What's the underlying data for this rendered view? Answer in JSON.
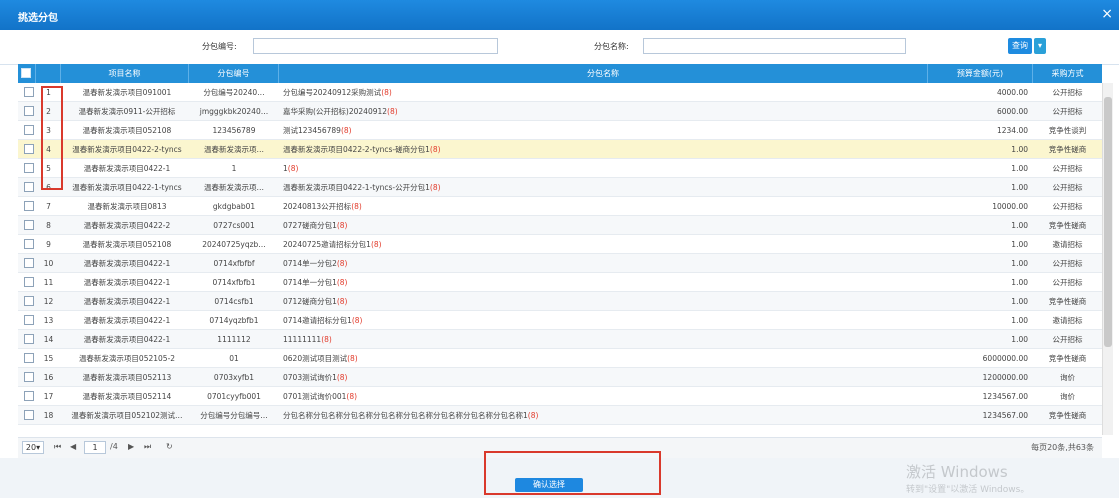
{
  "window": {
    "title": "挑选分包",
    "close_glyph": "×"
  },
  "search": {
    "package_no_label": "分包编号:",
    "package_no_value": "",
    "package_name_label": "分包名称:",
    "package_name_value": "",
    "search_button": "查询",
    "dropdown_glyph": "▾"
  },
  "table": {
    "headers": [
      "",
      "",
      "项目名称",
      "分包编号",
      "分包名称",
      "预算金额(元)",
      "采购方式"
    ],
    "rows": [
      {
        "num": "1",
        "project": "温春新发演示项目091001",
        "pkg_no": "分包编号20240…",
        "pkg_name": "分包编号20240912采购测试",
        "mark": "(8)",
        "amount": "4000.00",
        "method": "公开招标"
      },
      {
        "num": "2",
        "project": "温春新发演示0911-公开招标",
        "pkg_no": "jmgggkbk20240…",
        "pkg_name": "嘉华采购(公开招标)20240912",
        "mark": "(8)",
        "amount": "6000.00",
        "method": "公开招标"
      },
      {
        "num": "3",
        "project": "温春新发演示项目052108",
        "pkg_no": "123456789",
        "pkg_name": "测试123456789",
        "mark": "(8)",
        "amount": "1234.00",
        "method": "竞争性谈判"
      },
      {
        "num": "4",
        "project": "温春新发演示项目0422-2-tyncs",
        "pkg_no": "温春新发演示项…",
        "pkg_name": "温春新发演示项目0422-2-tyncs-磋商分包1",
        "mark": "(8)",
        "amount": "1.00",
        "method": "竞争性磋商"
      },
      {
        "num": "5",
        "project": "温春新发演示项目0422-1",
        "pkg_no": "1",
        "pkg_name": "1",
        "mark": "(8)",
        "amount": "1.00",
        "method": "公开招标"
      },
      {
        "num": "6",
        "project": "温春新发演示项目0422-1-tyncs",
        "pkg_no": "温春新发演示项…",
        "pkg_name": "温春新发演示项目0422-1-tyncs-公开分包1",
        "mark": "(8)",
        "amount": "1.00",
        "method": "公开招标"
      },
      {
        "num": "7",
        "project": "温春新发演示项目0813",
        "pkg_no": "gkdgbab01",
        "pkg_name": "20240813公开招标",
        "mark": "(8)",
        "amount": "10000.00",
        "method": "公开招标"
      },
      {
        "num": "8",
        "project": "温春新发演示项目0422-2",
        "pkg_no": "0727cs001",
        "pkg_name": "0727磋商分包1",
        "mark": "(8)",
        "amount": "1.00",
        "method": "竞争性磋商"
      },
      {
        "num": "9",
        "project": "温春新发演示项目052108",
        "pkg_no": "20240725yqzb…",
        "pkg_name": "20240725邀请招标分包1",
        "mark": "(8)",
        "amount": "1.00",
        "method": "邀请招标"
      },
      {
        "num": "10",
        "project": "温春新发演示项目0422-1",
        "pkg_no": "0714xfbfbf",
        "pkg_name": "0714单一分包2",
        "mark": "(8)",
        "amount": "1.00",
        "method": "公开招标"
      },
      {
        "num": "11",
        "project": "温春新发演示项目0422-1",
        "pkg_no": "0714xfbfb1",
        "pkg_name": "0714单一分包1",
        "mark": "(8)",
        "amount": "1.00",
        "method": "公开招标"
      },
      {
        "num": "12",
        "project": "温春新发演示项目0422-1",
        "pkg_no": "0714csfb1",
        "pkg_name": "0712磋商分包1",
        "mark": "(8)",
        "amount": "1.00",
        "method": "竞争性磋商"
      },
      {
        "num": "13",
        "project": "温春新发演示项目0422-1",
        "pkg_no": "0714yqzbfb1",
        "pkg_name": "0714邀请招标分包1",
        "mark": "(8)",
        "amount": "1.00",
        "method": "邀请招标"
      },
      {
        "num": "14",
        "project": "温春新发演示项目0422-1",
        "pkg_no": "1111112",
        "pkg_name": "11111111",
        "mark": "(8)",
        "amount": "1.00",
        "method": "公开招标"
      },
      {
        "num": "15",
        "project": "温春新发演示项目052105-2",
        "pkg_no": "01",
        "pkg_name": "0620测试项目测试",
        "mark": "(8)",
        "amount": "6000000.00",
        "method": "竞争性磋商"
      },
      {
        "num": "16",
        "project": "温春新发演示项目052113",
        "pkg_no": "0703xyfb1",
        "pkg_name": "0703测试询价1",
        "mark": "(8)",
        "amount": "1200000.00",
        "method": "询价"
      },
      {
        "num": "17",
        "project": "温春新发演示项目052114",
        "pkg_no": "0701cyyfb001",
        "pkg_name": "0701测试询价001",
        "mark": "(8)",
        "amount": "1234567.00",
        "method": "询价"
      },
      {
        "num": "18",
        "project": "温春新发演示项目052102测试…",
        "pkg_no": "分包编号分包编号…",
        "pkg_name": "分包名称分包名称分包名称分包名称分包名称分包名称分包名称分包名称1",
        "mark": "(8)",
        "amount": "1234567.00",
        "method": "竞争性磋商"
      }
    ]
  },
  "pager": {
    "page_size": "20",
    "size_caret": "▾",
    "first": "⏮",
    "prev": "◀",
    "current_page": "1",
    "of_pages": "/4",
    "next": "▶",
    "last": "⏭",
    "refresh": "↻",
    "summary": "每页20条,共63条"
  },
  "footer": {
    "confirm_button": "确认选择"
  },
  "watermark": {
    "line1": "激活 Windows",
    "line2": "转到\"设置\"以激活 Windows。"
  }
}
